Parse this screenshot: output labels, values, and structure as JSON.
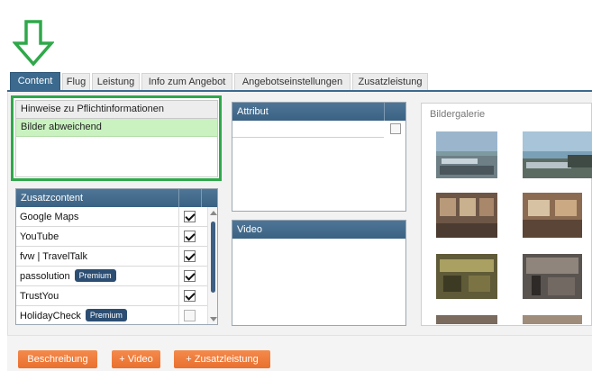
{
  "tabs": [
    {
      "label": "Content",
      "active": true
    },
    {
      "label": "Flug"
    },
    {
      "label": "Leistung"
    },
    {
      "label": "Info zum Angebot"
    },
    {
      "label": "Angebotseinstellungen"
    },
    {
      "label": "Zusatzleistung"
    }
  ],
  "hinweise": {
    "header": "Hinweise zu Pflichtinformationen",
    "rows": [
      "Bilder abweichend"
    ]
  },
  "zusatzcontent": {
    "header": "Zusatzcontent",
    "rows": [
      {
        "name": "Google Maps",
        "checked": true
      },
      {
        "name": "YouTube",
        "checked": true
      },
      {
        "name": "fvw | TravelTalk",
        "checked": true
      },
      {
        "name": "passolution",
        "badge": "Premium",
        "checked": true
      },
      {
        "name": "TrustYou",
        "checked": true
      },
      {
        "name": "HolidayCheck",
        "badge": "Premium",
        "checked": false
      }
    ]
  },
  "attribut": {
    "header": "Attribut",
    "value": "",
    "checked": false
  },
  "video": {
    "header": "Video"
  },
  "gallery": {
    "title": "Bildergalerie"
  },
  "buttons": {
    "beschreibung": "Beschreibung",
    "video": "+ Video",
    "zusatzleistung": "+ Zusatzleistung"
  },
  "colors": {
    "annotation": "#2fa84a",
    "tab_active": "#3b6a8e",
    "header_dark": "#3a6283",
    "highlight_row": "#c9f2c0",
    "button": "#ee7a3a",
    "badge": "#2c4e73"
  }
}
